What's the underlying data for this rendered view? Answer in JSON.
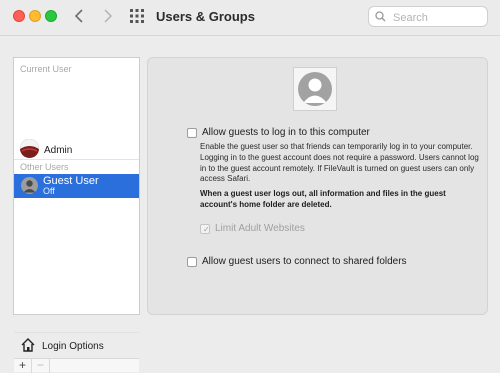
{
  "window": {
    "title": "Users & Groups",
    "search_placeholder": "Search"
  },
  "sidebar": {
    "current_user_header": "Current User",
    "current_user": {
      "name": "Admin"
    },
    "other_users_header": "Other Users",
    "other_users": [
      {
        "name": "Guest User",
        "status": "Off",
        "selected": true
      }
    ],
    "login_options_label": "Login Options",
    "add_label": "+",
    "remove_label": "−"
  },
  "guest_panel": {
    "allow_login": {
      "label": "Allow guests to log in to this computer",
      "checked": false
    },
    "description": "Enable the guest user so that friends can temporarily log in to your computer. Logging in to the guest account does not require a password. Users cannot log in to the guest account remotely. If FileVault is turned on guest users can only access Safari.",
    "warning": "When a guest user logs out, all information and files in the guest account's home folder are deleted.",
    "limit_adult": {
      "label": "Limit Adult Websites",
      "checked": true,
      "enabled": false
    },
    "shared_folders": {
      "label": "Allow guest users to connect to shared folders",
      "checked": false
    }
  },
  "colors": {
    "selection": "#2a6fdb",
    "close": "#ff5f57",
    "minimize": "#febc2e",
    "zoom": "#28c840"
  },
  "icons": [
    "back-chevron-icon",
    "forward-chevron-icon",
    "grid-icon",
    "search-icon",
    "guest-avatar-icon",
    "house-icon"
  ]
}
